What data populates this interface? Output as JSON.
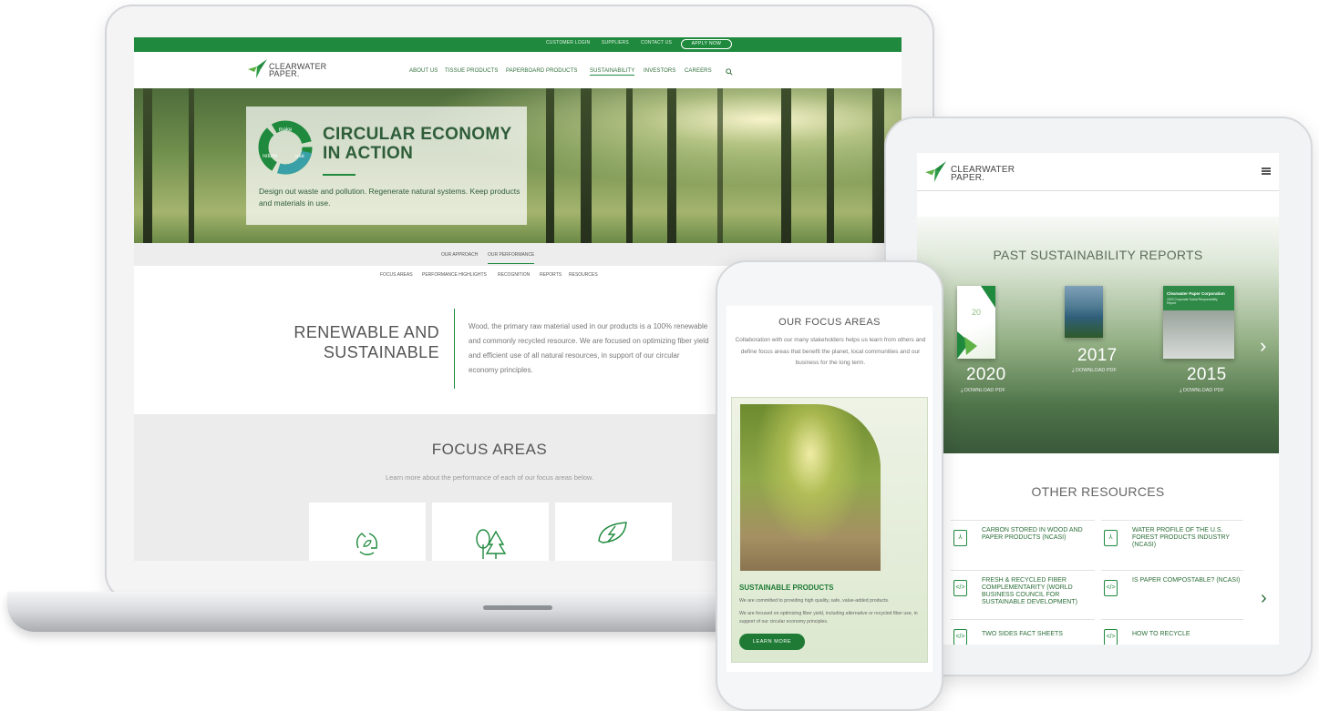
{
  "brand": {
    "name_line1": "CLEARWATER",
    "name_line2": "PAPER."
  },
  "colors": {
    "brand_green": "#1f8a3d",
    "dark_green": "#2e5d39",
    "text_gray": "#555555"
  },
  "laptop": {
    "topbar": {
      "link1": "CUSTOMER LOGIN",
      "link2": "SUPPLIERS",
      "link3": "CONTACT US",
      "apply": "APPLY NOW"
    },
    "nav": [
      "ABOUT US",
      "TISSUE PRODUCTS",
      "PAPERBOARD PRODUCTS",
      "SUSTAINABILITY",
      "INVESTORS",
      "CAREERS"
    ],
    "nav_active": "SUSTAINABILITY",
    "search_icon": "search-icon",
    "hero": {
      "badge_words": [
        "make",
        "use",
        "return"
      ],
      "title_line1": "CIRCULAR ECONOMY",
      "title_line2": "IN ACTION",
      "description": "Design out waste and pollution. Regenerate natural systems. Keep products and materials in use."
    },
    "subnav_primary": [
      "OUR APPROACH",
      "OUR PERFORMANCE"
    ],
    "subnav_secondary": [
      "FOCUS AREAS",
      "PERFORMANCE HIGHLIGHTS",
      "RECOGNITION",
      "REPORTS",
      "RESOURCES"
    ],
    "renewable": {
      "title_line1": "RENEWABLE AND",
      "title_line2": "SUSTAINABLE",
      "body": "Wood, the primary raw material used in our products is a 100% renewable and commonly recycled resource. We are focused on optimizing fiber yield and efficient use of all natural resources, in support of our circular economy principles."
    },
    "focus": {
      "title": "FOCUS AREAS",
      "subtitle": "Learn more about the performance of each of our focus areas below.",
      "card_icons": [
        "recycle-leaf-icon",
        "trees-icon",
        "energy-leaf-icon"
      ]
    }
  },
  "tablet": {
    "menu_icon": "hamburger-icon",
    "reports": {
      "title": "PAST SUSTAINABILITY REPORTS",
      "items": [
        {
          "year": "2020",
          "download": "DOWNLOAD PDF"
        },
        {
          "year": "2017",
          "download": "DOWNLOAD PDF"
        },
        {
          "year": "2015",
          "download": "DOWNLOAD PDF"
        }
      ],
      "cover_2015_title": "Clearwater Paper Corporation",
      "cover_2015_sub": "2015 Corporate Social Responsibility Report",
      "cover_2020_number": "20"
    },
    "other": {
      "title": "OTHER RESOURCES",
      "items": [
        {
          "label": "CARBON STORED IN WOOD AND PAPER PRODUCTS (NCASI)",
          "icon": "pdf-icon"
        },
        {
          "label": "WATER PROFILE OF THE U.S. FOREST PRODUCTS INDUSTRY (NCASI)",
          "icon": "pdf-icon"
        },
        {
          "label": "FRESH & RECYCLED FIBER COMPLEMENTARITY (WORLD BUSINESS COUNCIL FOR SUSTAINABLE DEVELOPMENT)",
          "icon": "code-doc-icon"
        },
        {
          "label": "IS PAPER COMPOSTABLE? (NCASI)",
          "icon": "code-doc-icon"
        },
        {
          "label": "TWO SIDES FACT SHEETS",
          "icon": "code-doc-icon"
        },
        {
          "label": "HOW TO RECYCLE",
          "icon": "code-doc-icon"
        }
      ]
    }
  },
  "phone": {
    "title": "OUR FOCUS AREAS",
    "intro": "Collaboration with our many stakeholders helps us learn from others and define focus areas that benefit the planet, local communities and our business for the long term.",
    "card": {
      "heading": "SUSTAINABLE PRODUCTS",
      "body1": "We are committed to providing high quality, safe, value-added products.",
      "body2": "We are focused on optimizing fiber yield, including alternative or recycled fiber use, in support of our circular economy principles.",
      "button": "LEARN MORE"
    }
  }
}
